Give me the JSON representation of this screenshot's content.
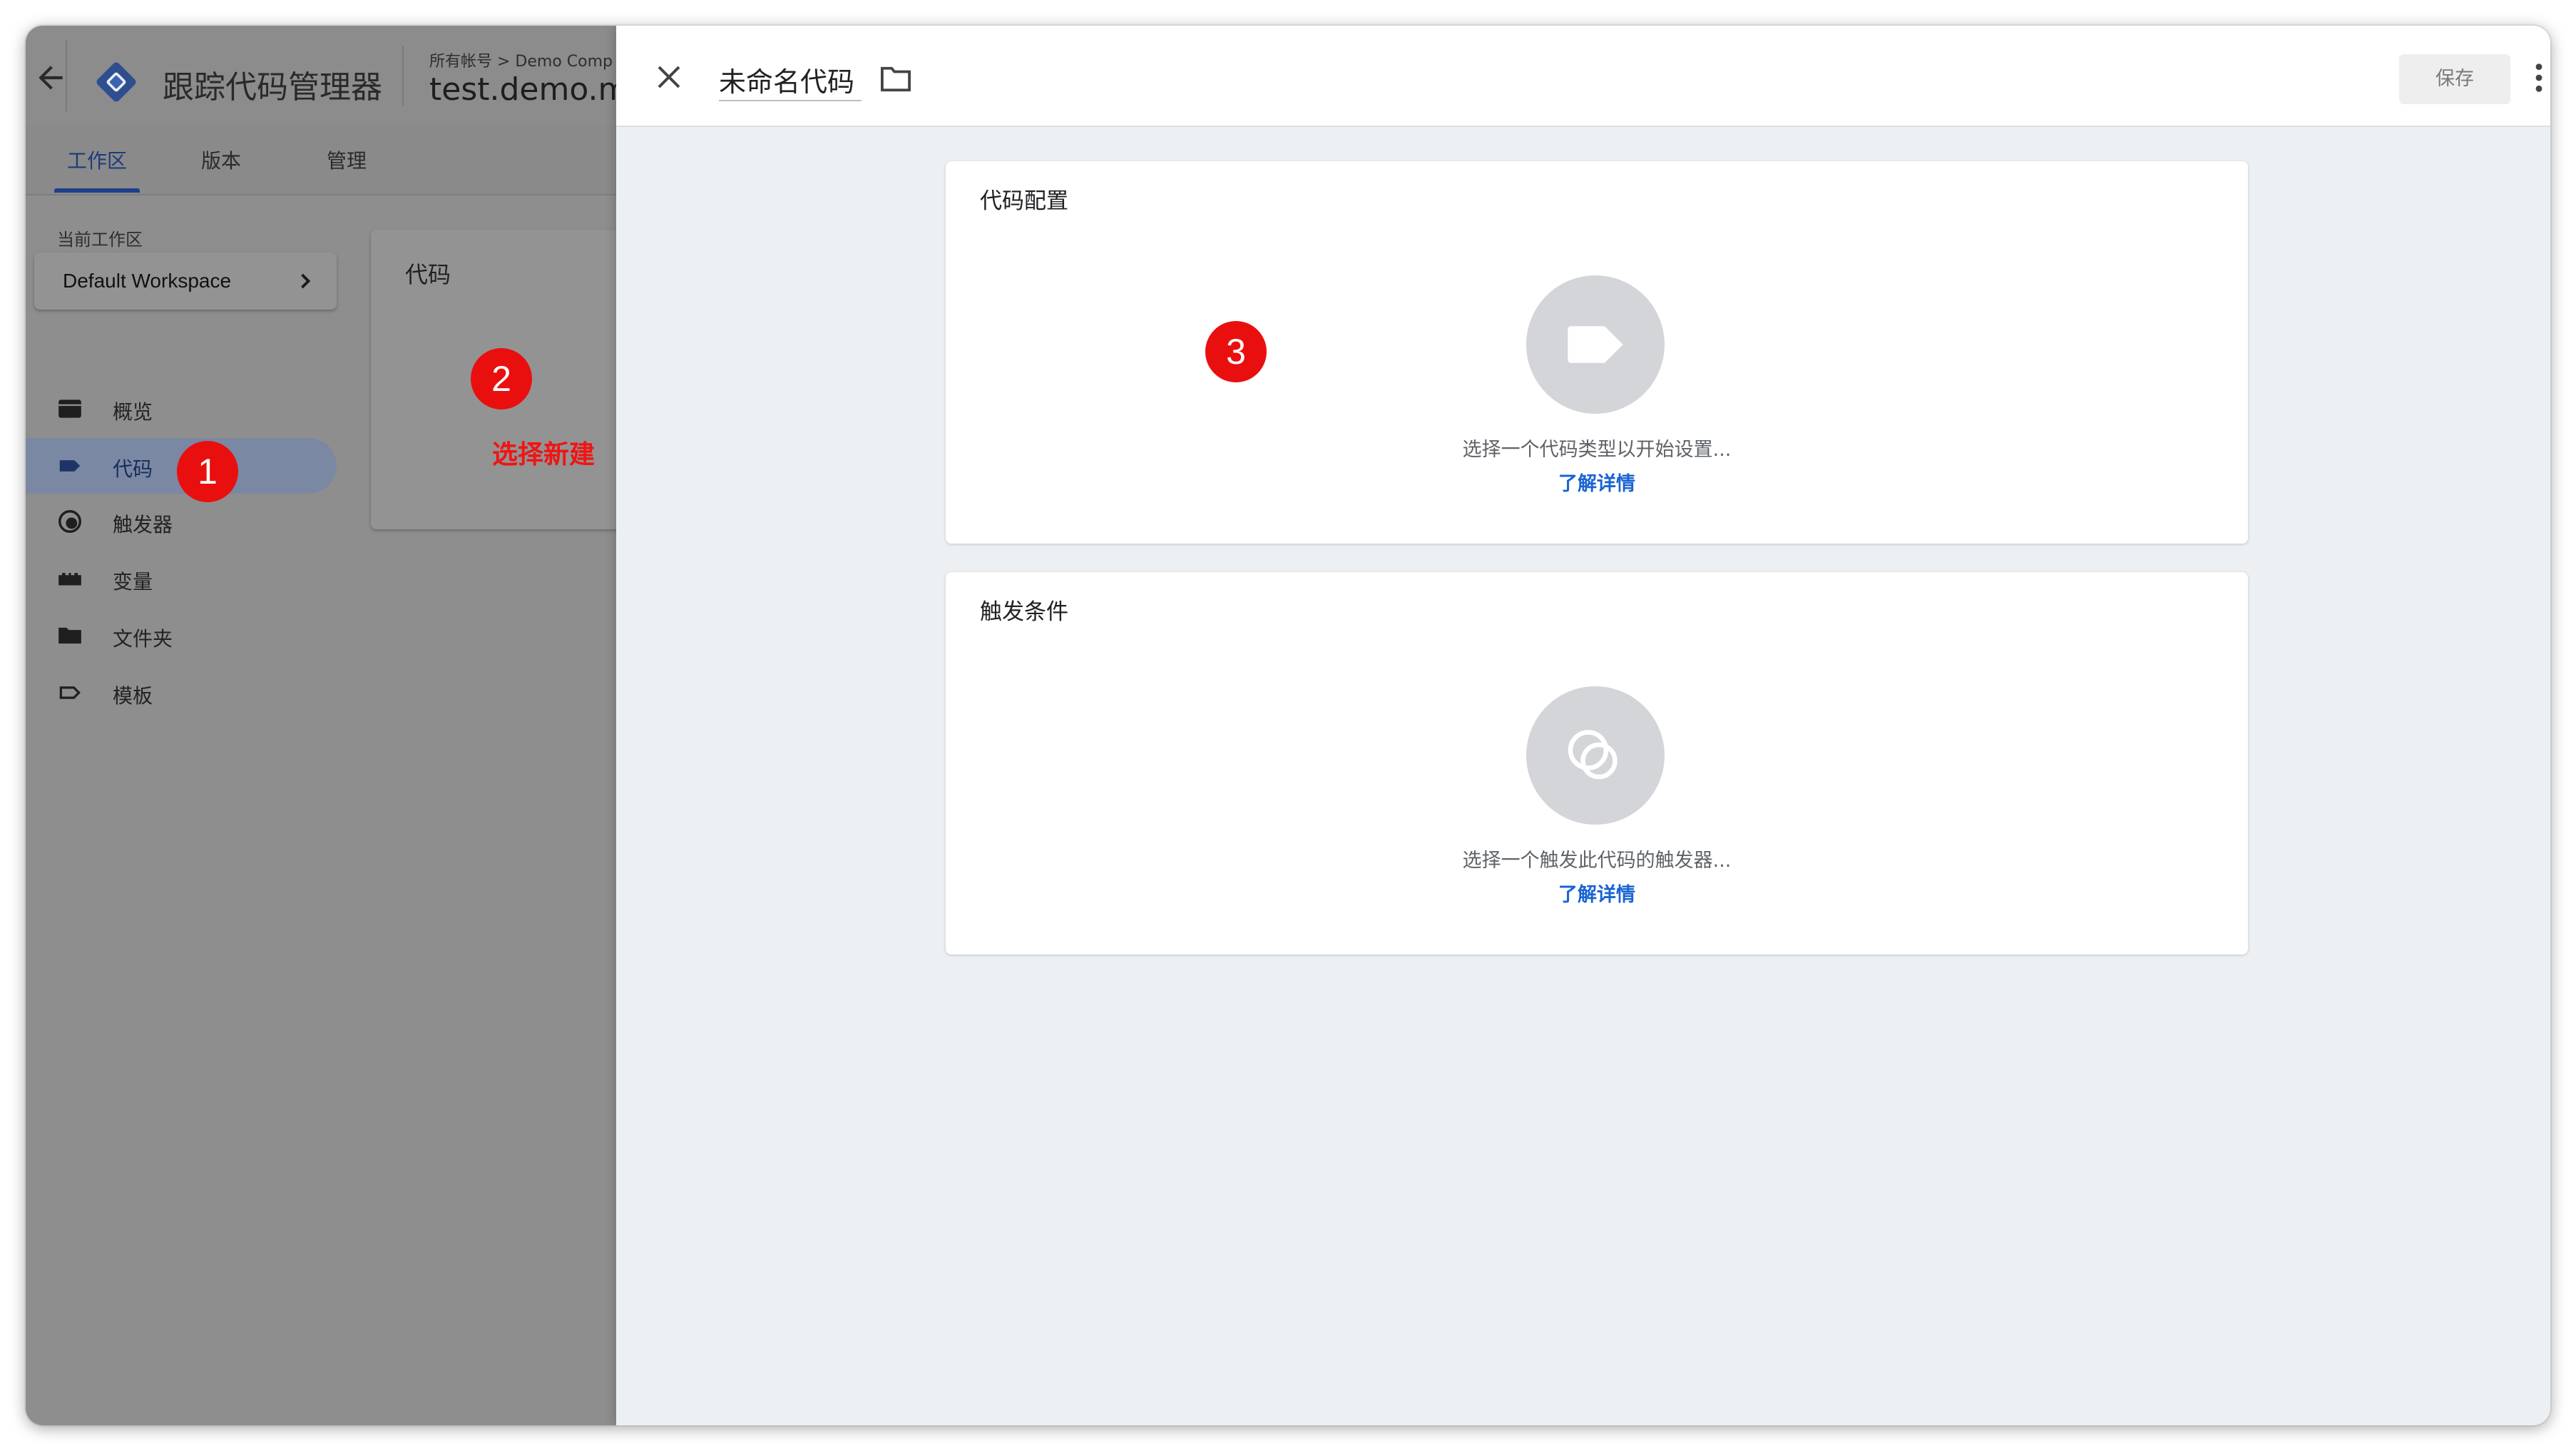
{
  "app": {
    "title": "跟踪代码管理器",
    "breadcrumb_small": "所有帐号 > Demo Comp",
    "container_name": "test.demo.m",
    "tabs": [
      {
        "label": "工作区"
      },
      {
        "label": "版本"
      },
      {
        "label": "管理"
      }
    ],
    "workspace": {
      "label": "当前工作区",
      "name": "Default Workspace"
    },
    "sidebar": {
      "items": [
        {
          "label": "概览",
          "icon": "overview-icon"
        },
        {
          "label": "代码",
          "icon": "tag-icon"
        },
        {
          "label": "触发器",
          "icon": "trigger-icon"
        },
        {
          "label": "变量",
          "icon": "variable-icon"
        },
        {
          "label": "文件夹",
          "icon": "folder-icon"
        },
        {
          "label": "模板",
          "icon": "template-icon"
        }
      ]
    },
    "tags_card_title": "代码"
  },
  "annotations": {
    "badge1": "1",
    "badge2": "2",
    "badge3": "3",
    "hint": "选择新建"
  },
  "editor": {
    "tag_name": "未命名代码",
    "save_label": "保存",
    "tag_config": {
      "title": "代码配置",
      "prompt": "选择一个代码类型以开始设置...",
      "link": "了解详情"
    },
    "triggering": {
      "title": "触发条件",
      "prompt": "选择一个触发此代码的触发器...",
      "link": "了解详情"
    }
  },
  "colors": {
    "accent_blue": "#1a64d2",
    "annotation_red": "#ea0f0f",
    "save_bg": "#eeeeee"
  }
}
